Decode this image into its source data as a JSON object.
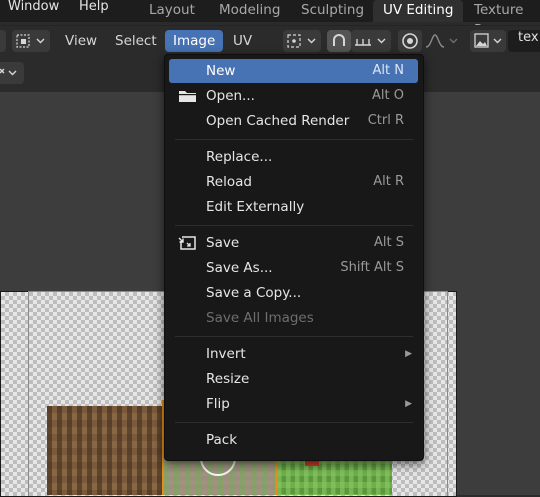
{
  "topbar": {
    "menus": [
      "Window",
      "Help"
    ],
    "workspaces": [
      "Layout",
      "Modeling",
      "Sculpting",
      "UV Editing",
      "Texture Pa"
    ],
    "active_workspace": "UV Editing"
  },
  "header": {
    "view": "View",
    "select": "Select",
    "image": "Image",
    "uv": "UV",
    "image_name": "tex"
  },
  "image_menu": {
    "items": [
      {
        "label": "New",
        "shortcut": "Alt N",
        "highlighted": true
      },
      {
        "label": "Open...",
        "shortcut": "Alt O",
        "icon": "folder-icon"
      },
      {
        "label": "Open Cached Render",
        "shortcut": "Ctrl R"
      },
      {
        "label": "Replace...",
        "shortcut": ""
      },
      {
        "label": "Reload",
        "shortcut": "Alt R"
      },
      {
        "label": "Edit Externally",
        "shortcut": ""
      },
      {
        "label": "Save",
        "shortcut": "Alt S",
        "icon": "save-icon"
      },
      {
        "label": "Save As...",
        "shortcut": "Shift Alt S"
      },
      {
        "label": "Save a Copy...",
        "shortcut": ""
      },
      {
        "label": "Save All Images",
        "shortcut": "",
        "disabled": true
      },
      {
        "label": "Invert",
        "submenu": true
      },
      {
        "label": "Resize",
        "shortcut": ""
      },
      {
        "label": "Flip",
        "submenu": true
      },
      {
        "label": "Pack",
        "shortcut": ""
      }
    ]
  },
  "colors": {
    "accent": "#4772b3",
    "uv_edge": "#e38d1c",
    "menu_bg": "#181818"
  }
}
